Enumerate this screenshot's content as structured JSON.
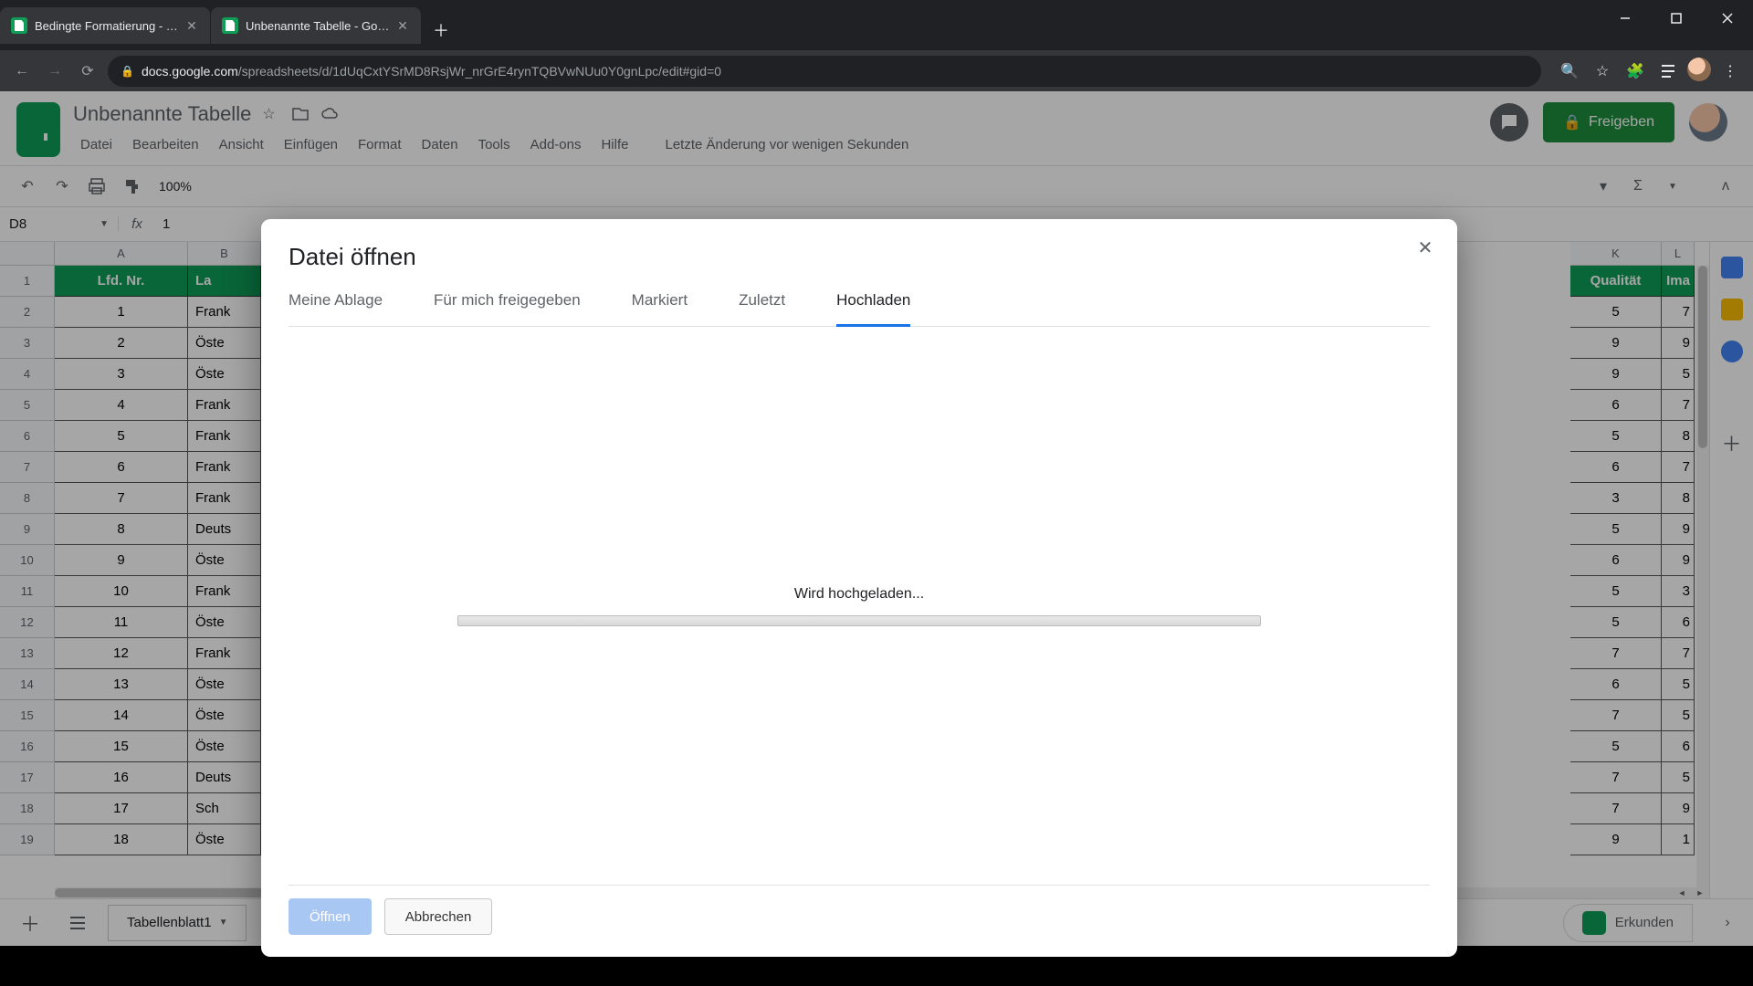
{
  "browser": {
    "tabs": [
      {
        "title": "Bedingte Formatierung - Google T"
      },
      {
        "title": "Unbenannte Tabelle - Google Ta"
      }
    ],
    "url_domain": "docs.google.com",
    "url_path": "/spreadsheets/d/1dUqCxtYSrMD8RsjWr_nrGrE4rynTQBVwNUu0Y0gnLpc/edit#gid=0"
  },
  "app": {
    "doc_title": "Unbenannte Tabelle",
    "menus": [
      "Datei",
      "Bearbeiten",
      "Ansicht",
      "Einfügen",
      "Format",
      "Daten",
      "Tools",
      "Add-ons",
      "Hilfe"
    ],
    "last_edit": "Letzte Änderung vor wenigen Sekunden",
    "share_label": "Freigeben",
    "zoom": "100%",
    "cell_ref": "D8",
    "formula_value": "1",
    "sheet_tab": "Tabellenblatt1",
    "explore_label": "Erkunden"
  },
  "grid": {
    "col_letters": [
      "A",
      "B"
    ],
    "right_col_letters": [
      "K",
      "L"
    ],
    "header": {
      "A": "Lfd. Nr.",
      "B": "La",
      "K": "Qualität",
      "L": "Ima"
    },
    "rows": [
      {
        "n": 1,
        "A": "1",
        "B": "Frank",
        "K": "5",
        "L": "7"
      },
      {
        "n": 2,
        "A": "2",
        "B": "Öste",
        "K": "9",
        "L": "9"
      },
      {
        "n": 3,
        "A": "3",
        "B": "Öste",
        "K": "9",
        "L": "5"
      },
      {
        "n": 4,
        "A": "4",
        "B": "Frank",
        "K": "6",
        "L": "7"
      },
      {
        "n": 5,
        "A": "5",
        "B": "Frank",
        "K": "5",
        "L": "8"
      },
      {
        "n": 6,
        "A": "6",
        "B": "Frank",
        "K": "6",
        "L": "7"
      },
      {
        "n": 7,
        "A": "7",
        "B": "Frank",
        "K": "3",
        "L": "8"
      },
      {
        "n": 8,
        "A": "8",
        "B": "Deuts",
        "K": "5",
        "L": "9"
      },
      {
        "n": 9,
        "A": "9",
        "B": "Öste",
        "K": "6",
        "L": "9"
      },
      {
        "n": 10,
        "A": "10",
        "B": "Frank",
        "K": "5",
        "L": "3"
      },
      {
        "n": 11,
        "A": "11",
        "B": "Öste",
        "K": "5",
        "L": "6"
      },
      {
        "n": 12,
        "A": "12",
        "B": "Frank",
        "K": "7",
        "L": "7"
      },
      {
        "n": 13,
        "A": "13",
        "B": "Öste",
        "K": "6",
        "L": "5"
      },
      {
        "n": 14,
        "A": "14",
        "B": "Öste",
        "K": "7",
        "L": "5"
      },
      {
        "n": 15,
        "A": "15",
        "B": "Öste",
        "K": "5",
        "L": "6"
      },
      {
        "n": 16,
        "A": "16",
        "B": "Deuts",
        "K": "7",
        "L": "5"
      },
      {
        "n": 17,
        "A": "17",
        "B": "Sch",
        "K": "7",
        "L": "9"
      },
      {
        "n": 18,
        "A": "18",
        "B": "Öste",
        "K": "9",
        "L": "1"
      }
    ]
  },
  "modal": {
    "title": "Datei öffnen",
    "tabs": [
      "Meine Ablage",
      "Für mich freigegeben",
      "Markiert",
      "Zuletzt",
      "Hochladen"
    ],
    "active_tab_index": 4,
    "upload_status": "Wird hochgeladen...",
    "open_label": "Öffnen",
    "cancel_label": "Abbrechen"
  }
}
